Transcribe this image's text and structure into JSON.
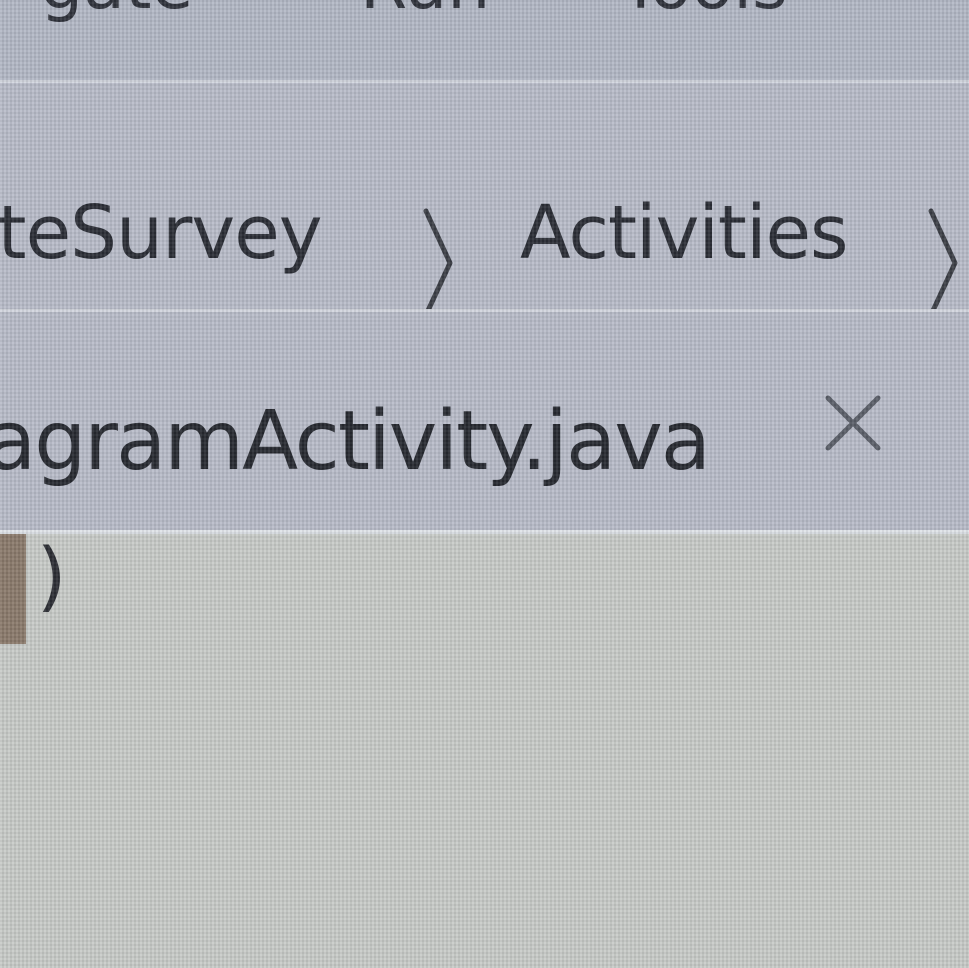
{
  "menu_bar": {
    "items": [
      "gate",
      "Run",
      "Tools"
    ]
  },
  "breadcrumb": {
    "items": [
      "iteSurvey",
      "Activities"
    ],
    "separator_icon": "chevron-right-icon"
  },
  "tab": {
    "title": "agramActivity.java",
    "close_icon": "close-icon"
  },
  "editor": {
    "visible_code": ")"
  },
  "colors": {
    "toolbar_bg": "#b8bcc9",
    "editor_bg": "#c8cbc8",
    "text": "#2a2d35"
  }
}
